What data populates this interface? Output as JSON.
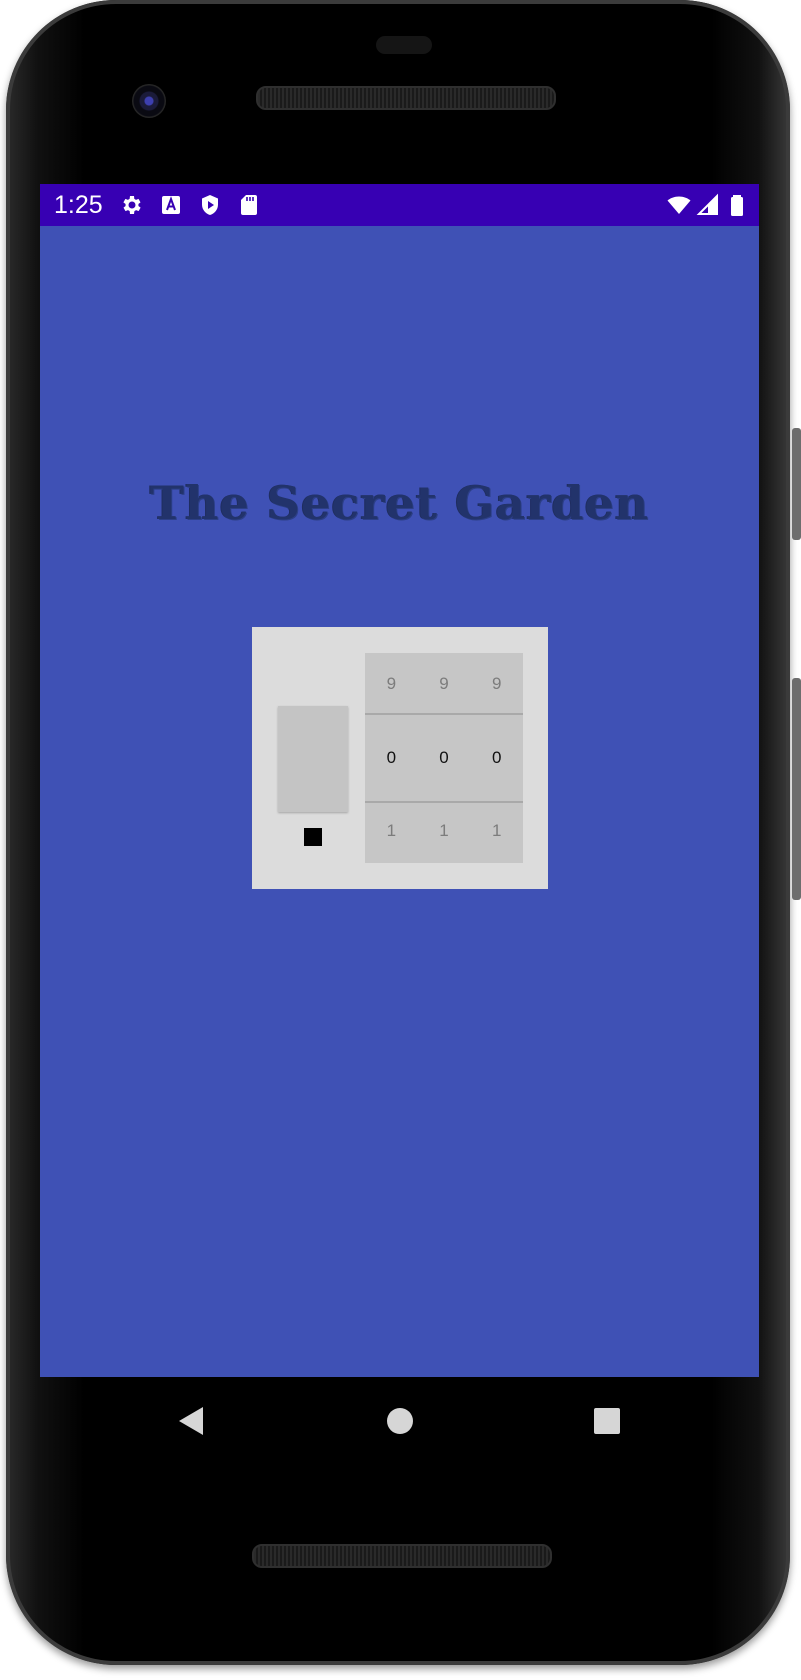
{
  "status_bar": {
    "time": "1:25",
    "left_icons": [
      "settings-icon",
      "text-recognition-icon",
      "play-protect-icon",
      "sd-card-icon"
    ],
    "right_icons": [
      "wifi-icon",
      "cell-signal-icon",
      "battery-icon"
    ],
    "color": "#3700b3"
  },
  "app": {
    "title": "The Secret Garden",
    "background_color": "#3f51b5",
    "lock": {
      "dials": {
        "above": [
          "9",
          "9",
          "9"
        ],
        "selected": [
          "0",
          "0",
          "0"
        ],
        "below": [
          "1",
          "1",
          "1"
        ]
      }
    }
  },
  "nav_bar": {
    "buttons": [
      "back-icon",
      "home-icon",
      "recents-icon"
    ]
  }
}
